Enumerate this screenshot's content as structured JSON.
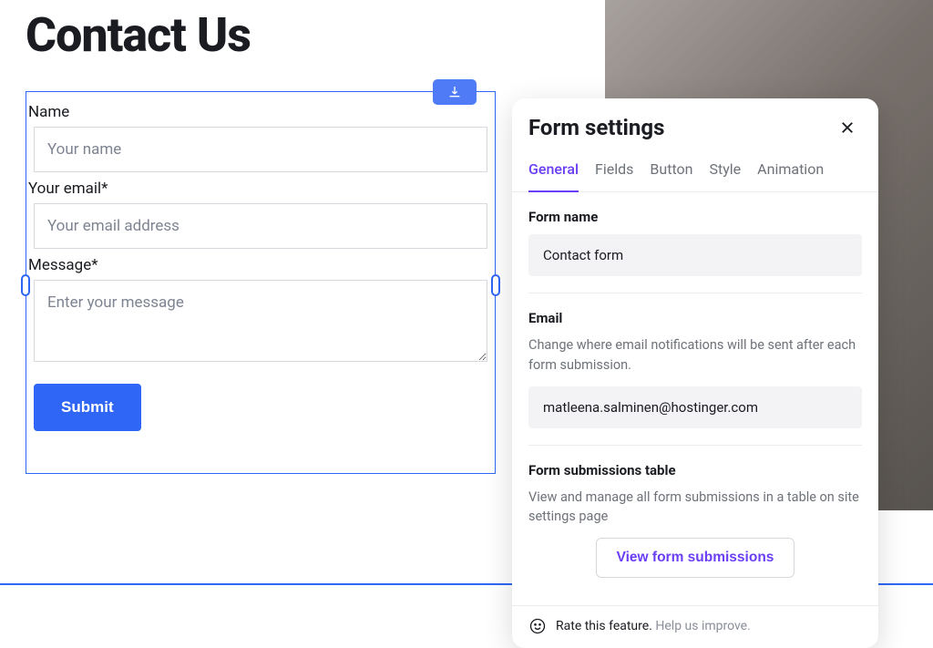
{
  "page": {
    "heading": "Contact Us"
  },
  "form": {
    "fields": [
      {
        "label": "Name",
        "placeholder": "Your name",
        "type": "text"
      },
      {
        "label": "Your email*",
        "placeholder": "Your email address",
        "type": "email"
      },
      {
        "label": "Message*",
        "placeholder": "Enter your message",
        "type": "textarea"
      }
    ],
    "submit_label": "Submit"
  },
  "panel": {
    "title": "Form settings",
    "tabs": [
      "General",
      "Fields",
      "Button",
      "Style",
      "Animation"
    ],
    "active_tab": "General",
    "sections": {
      "form_name": {
        "label": "Form name",
        "value": "Contact form"
      },
      "email": {
        "label": "Email",
        "desc": "Change where email notifications will be sent after each form submission.",
        "value": "matleena.salminen@hostinger.com"
      },
      "submissions": {
        "label": "Form submissions table",
        "desc": "View and manage all form submissions in a table on site settings page",
        "button": "View form submissions"
      }
    },
    "footer": {
      "strong": "Rate this feature.",
      "muted": "Help us improve."
    }
  }
}
